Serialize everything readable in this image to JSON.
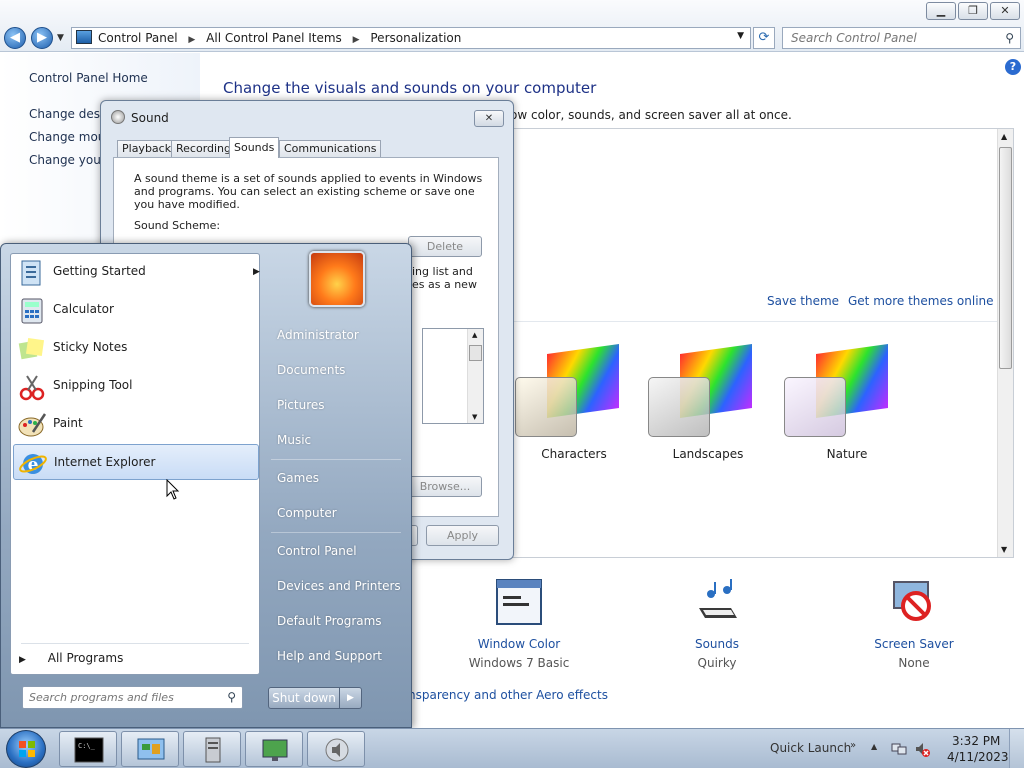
{
  "window": {
    "minimize": "▁",
    "maximize": "❐",
    "close": "✕"
  },
  "nav": {
    "back": "◀",
    "forward": "▶",
    "dropdown": "▼"
  },
  "address": {
    "crumbs": [
      "Control Panel",
      "All Control Panel Items",
      "Personalization"
    ],
    "separator": "▶",
    "dropdown": "▼",
    "refresh": "⟳"
  },
  "search": {
    "placeholder": "Search Control Panel",
    "icon": "⚲"
  },
  "left_pane": {
    "home": "Control Panel Home",
    "links": [
      "Change deskt",
      "Change mous",
      "Change your"
    ]
  },
  "help": "?",
  "main": {
    "heading": "Change the visuals and sounds on your computer",
    "subtext": "ow color, sounds, and screen saver all at once.",
    "save_theme": "Save theme",
    "get_more": "Get more themes online",
    "themes": [
      {
        "label": "Characters"
      },
      {
        "label": "Landscapes"
      },
      {
        "label": "Nature"
      }
    ],
    "bottom": [
      {
        "link": "Window Color",
        "sub": "Windows 7 Basic",
        "icon": "window-color-icon"
      },
      {
        "link": "Sounds",
        "sub": "Quirky",
        "icon": "sounds-icon"
      },
      {
        "link": "Screen Saver",
        "sub": "None",
        "icon": "screen-saver-icon"
      }
    ],
    "aero_link": "nsparency and other Aero effects"
  },
  "sound_dialog": {
    "title": "Sound",
    "close": "✕",
    "tabs": [
      "Playback",
      "Recording",
      "Sounds",
      "Communications"
    ],
    "active_tab": "Sounds",
    "description": "A sound theme is a set of sounds applied to events in Windows and programs.  You can select an existing scheme or save one you have modified.",
    "scheme_label": "Sound Scheme:",
    "delete": "Delete",
    "fragment_1": "ing list and",
    "fragment_2": "es as a new",
    "browse": "Browse...",
    "apply": "Apply"
  },
  "start_menu": {
    "programs": [
      {
        "label": "Getting Started",
        "icon": "getting-started-icon",
        "has_submenu": true
      },
      {
        "label": "Calculator",
        "icon": "calculator-icon"
      },
      {
        "label": "Sticky Notes",
        "icon": "sticky-notes-icon"
      },
      {
        "label": "Snipping Tool",
        "icon": "snipping-tool-icon"
      },
      {
        "label": "Paint",
        "icon": "paint-icon"
      },
      {
        "label": "Internet Explorer",
        "icon": "internet-explorer-icon",
        "highlighted": true
      }
    ],
    "submenu_arrow": "▶",
    "all_programs": "All Programs",
    "all_programs_arrow": "▶",
    "search_placeholder": "Search programs and files",
    "search_icon": "⚲",
    "right_items": [
      "Administrator",
      "Documents",
      "Pictures",
      "Music",
      "Games",
      "Computer",
      "Control Panel",
      "Devices and Printers",
      "Default Programs",
      "Help and Support"
    ],
    "shutdown": "Shut down",
    "shutdown_arrow": "▶"
  },
  "taskbar": {
    "quick_launch": "Quick Launch",
    "ql_arrow": "»",
    "tray_up": "▲",
    "time": "3:32 PM",
    "date": "4/11/2023",
    "buttons": [
      "cmd-icon",
      "control-panel-icon",
      "server-manager-icon",
      "personalization-icon",
      "sound-icon"
    ]
  }
}
